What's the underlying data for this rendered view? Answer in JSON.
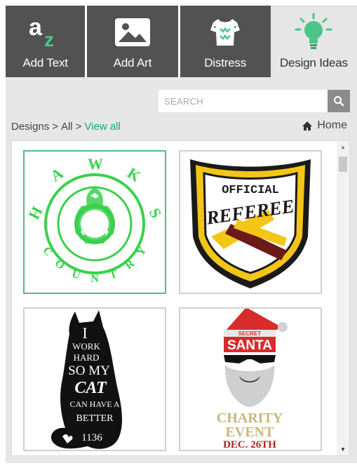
{
  "tabs": [
    {
      "label": "Add Text",
      "icon": "text-az-icon"
    },
    {
      "label": "Add Art",
      "icon": "image-icon"
    },
    {
      "label": "Distress",
      "icon": "shirt-icon"
    },
    {
      "label": "Design Ideas",
      "icon": "lightbulb-icon"
    }
  ],
  "search": {
    "placeholder": "SEARCH"
  },
  "breadcrumb": {
    "root": "Designs",
    "sep1": ">",
    "current": "All",
    "sep2": ">",
    "link": "View all"
  },
  "home": {
    "label": "Home"
  },
  "designs": {
    "hawks": {
      "letters": [
        "H",
        "A",
        "W",
        "K",
        "S"
      ],
      "bottom": [
        "C",
        "O",
        "U",
        "N",
        "T",
        "R",
        "Y"
      ]
    },
    "referee": {
      "line1": "OFFICIAL",
      "line2": "REFEREE"
    },
    "cat": {
      "lines": [
        "I",
        "WORK",
        "HARD",
        "SO MY",
        "CAT",
        "CAN HAVE A",
        "BETTER",
        "1136"
      ]
    },
    "santa": {
      "secret": "SECRET",
      "santa": "SANTA",
      "line1": "CHARITY",
      "line2": "EVENT",
      "line3": "DEC. 26TH"
    }
  },
  "colors": {
    "accent_green": "#1aa86f",
    "tab_dark": "#525252",
    "bulb_green": "#4cc48a",
    "hawks_green": "#3ad14c",
    "referee_gold": "#f3c516",
    "referee_maroon": "#6b1a1a",
    "santa_red": "#d82b2b"
  }
}
